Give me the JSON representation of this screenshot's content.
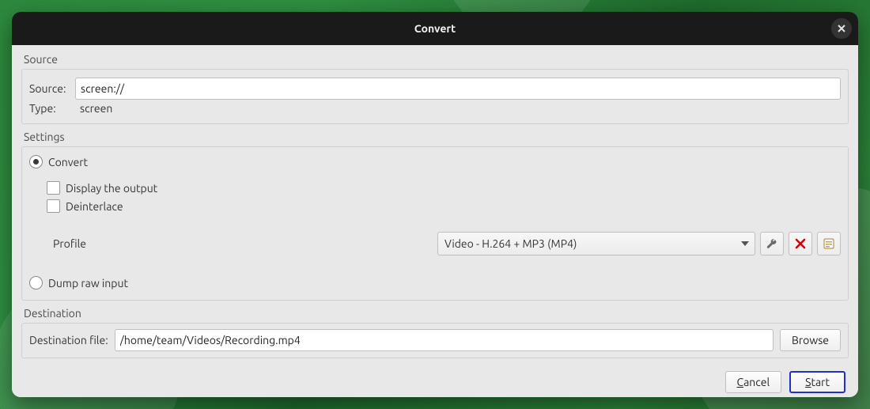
{
  "window": {
    "title": "Convert"
  },
  "sections": {
    "source_title": "Source",
    "settings_title": "Settings",
    "destination_title": "Destination"
  },
  "source": {
    "source_label": "Source:",
    "source_value": "screen://",
    "type_label": "Type:",
    "type_value": "screen"
  },
  "settings": {
    "convert_label": "Convert",
    "display_output_label": "Display the output",
    "deinterlace_label": "Deinterlace",
    "profile_label": "Profile",
    "profile_value": "Video - H.264 + MP3 (MP4)",
    "dump_raw_label": "Dump raw input"
  },
  "destination": {
    "file_label": "Destination file:",
    "file_value": "/home/team/Videos/Recording.mp4",
    "browse_label": "Browse"
  },
  "footer": {
    "cancel_label": "Cancel",
    "start_label": "Start"
  },
  "icons": {
    "close": "close-icon",
    "wrench": "wrench-icon",
    "delete_x": "delete-icon",
    "new_profile": "new-profile-icon",
    "dropdown": "chevron-down-icon"
  }
}
